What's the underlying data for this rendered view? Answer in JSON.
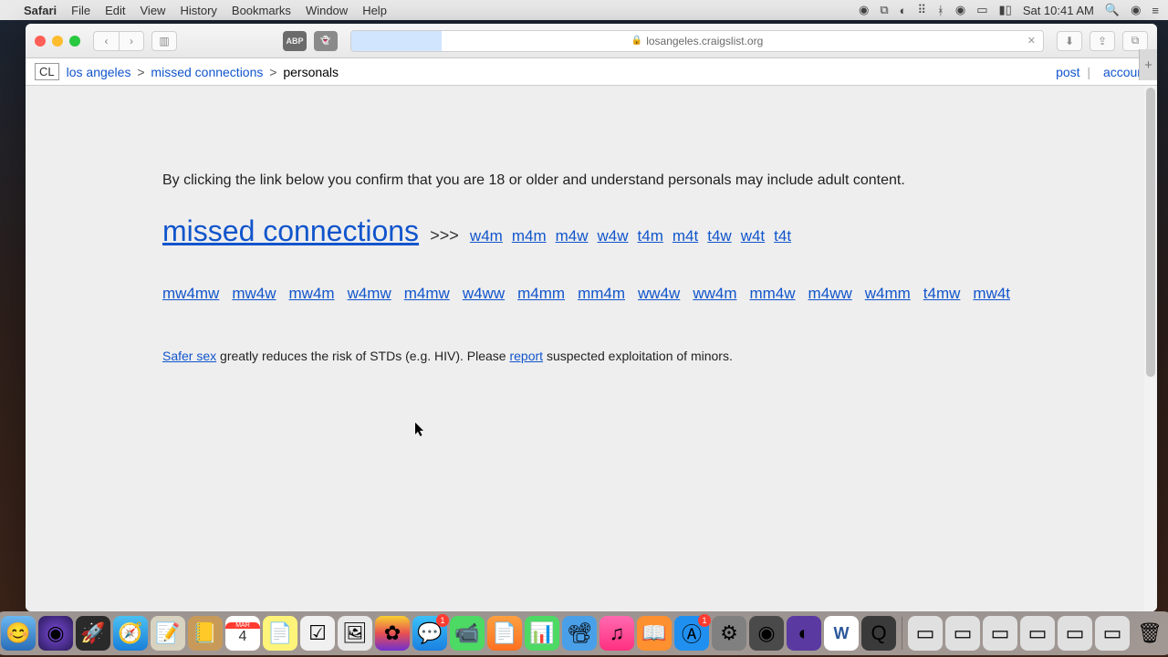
{
  "menubar": {
    "app": "Safari",
    "items": [
      "File",
      "Edit",
      "View",
      "History",
      "Bookmarks",
      "Window",
      "Help"
    ],
    "clock": "Sat 10:41 AM"
  },
  "toolbar": {
    "url_host": "losangeles.craigslist.org",
    "ext1": "ABP"
  },
  "header": {
    "logo": "CL",
    "bc_city": "los angeles",
    "bc_cat": "missed connections",
    "bc_sub": "personals",
    "post": "post",
    "account": "account"
  },
  "content": {
    "confirm": "By clicking the link below you confirm that you are 18 or older and understand personals may include adult content.",
    "main_link": "missed connections",
    "arrow": ">>>",
    "row1": [
      "w4m",
      "m4m",
      "m4w",
      "w4w",
      "t4m",
      "m4t",
      "t4w",
      "w4t",
      "t4t"
    ],
    "row2": [
      "mw4mw",
      "mw4w",
      "mw4m",
      "w4mw",
      "m4mw",
      "w4ww",
      "m4mm",
      "mm4m",
      "ww4w",
      "ww4m",
      "mm4w",
      "m4ww",
      "w4mm",
      "t4mw",
      "mw4t"
    ],
    "safer1": "Safer sex",
    "safer2": " greatly reduces the risk of STDs (e.g. HIV). Please ",
    "report": "report",
    "safer3": " suspected exploitation of minors."
  },
  "dock": {
    "calendar_day": "4"
  }
}
